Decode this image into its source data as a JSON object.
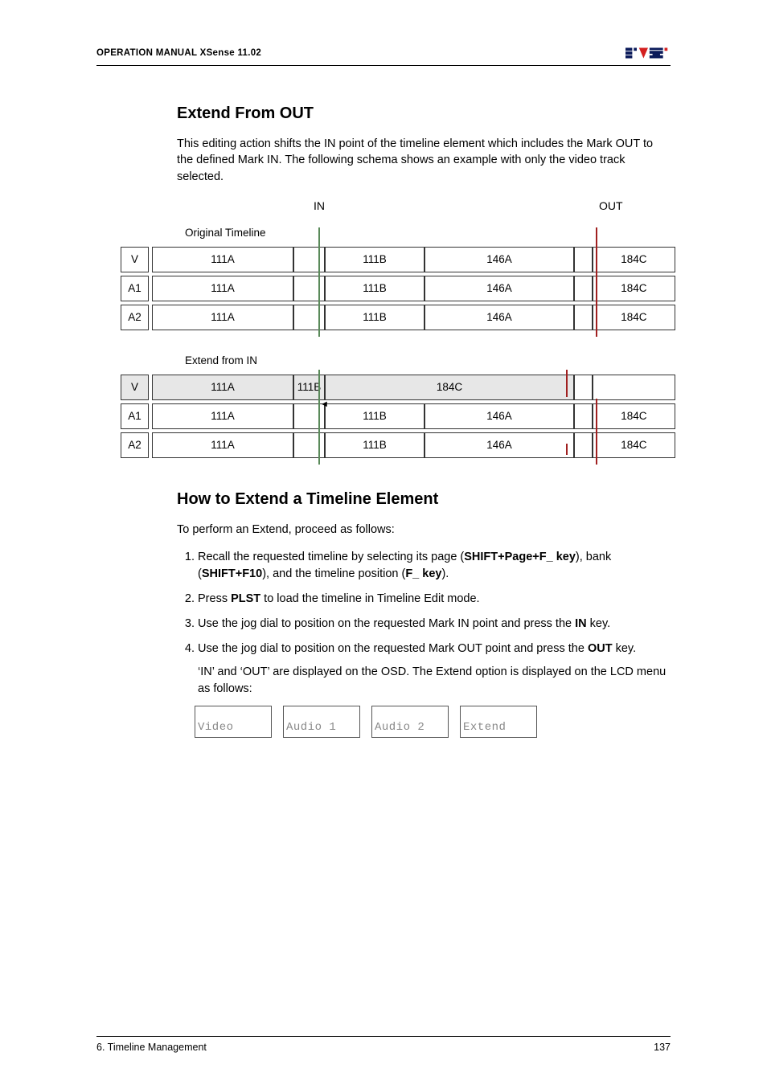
{
  "header": {
    "left": "OPERATION MANUAL XSense 11.02"
  },
  "footer": {
    "left": "6. Timeline Management",
    "right": "137"
  },
  "s1": {
    "title": "Extend From OUT",
    "para": "This editing action shifts the IN point of the timeline element which includes the Mark OUT to the defined Mark IN. The following schema shows an example with only the video track selected."
  },
  "diagram": {
    "in": "IN",
    "out": "OUT",
    "orig": "Original Timeline",
    "ext": "Extend from IN",
    "tracks": {
      "v": "V",
      "a1": "A1",
      "a2": "A2"
    },
    "clips": {
      "c1": "111A",
      "c2": "111B",
      "c3": "146A",
      "c4": "184C"
    }
  },
  "s2": {
    "title": "How to Extend a Timeline Element",
    "para": "To perform an Extend, proceed as follows:",
    "step1a": "Recall the requested timeline by selecting its page (",
    "step1b": "SHIFT+Page+F_ key",
    "step1c": "), bank (",
    "step1d": "SHIFT+F10",
    "step1e": "), and the timeline position (",
    "step1f": "F_ key",
    "step1g": ").",
    "step2a": "Press ",
    "step2b": "PLST",
    "step2c": " to load the timeline in Timeline Edit mode.",
    "step3a": "Use the jog dial to position on the requested Mark IN point and press the ",
    "step3b": "IN",
    "step3c": " key.",
    "step4a": "Use the jog dial to position on the requested Mark OUT point and press the ",
    "step4b": "OUT",
    "step4c": " key.",
    "step4sub": "‘IN’ and ‘OUT’ are displayed on the OSD. The Extend option is displayed on the LCD menu as follows:",
    "lcd": {
      "video": "Video",
      "a1": "Audio 1",
      "a2": "Audio 2",
      "ext": "Extend"
    }
  }
}
